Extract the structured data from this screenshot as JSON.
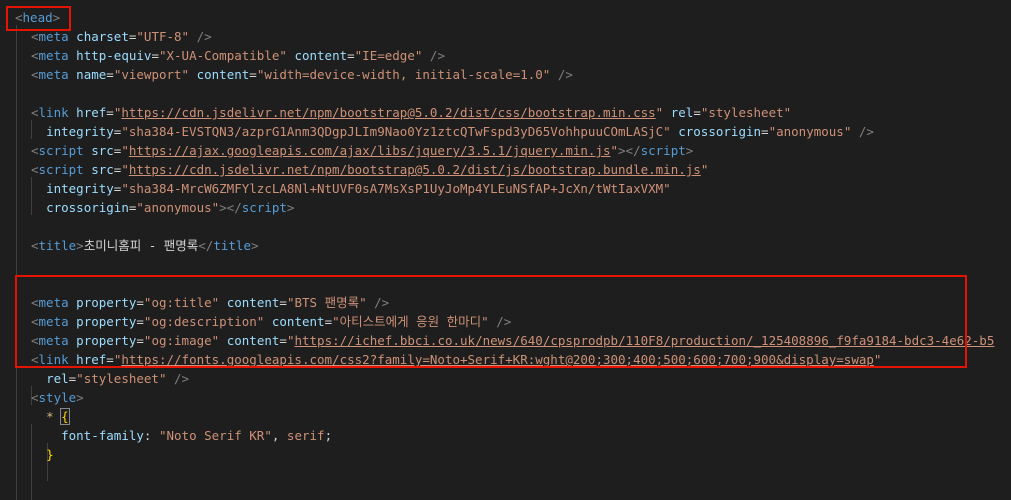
{
  "lines": [
    {
      "tokens": [
        [
          "br",
          "<"
        ],
        [
          "tag",
          "head"
        ],
        [
          "br",
          ">"
        ]
      ]
    },
    {
      "tokens": [
        [
          "br",
          "<"
        ],
        [
          "tag",
          "meta"
        ],
        [
          "sp",
          " "
        ],
        [
          "attr",
          "charset"
        ],
        [
          "eq",
          "="
        ],
        [
          "str",
          "\"UTF-8\""
        ],
        [
          "sp",
          " "
        ],
        [
          "br",
          "/>"
        ]
      ]
    },
    {
      "tokens": [
        [
          "br",
          "<"
        ],
        [
          "tag",
          "meta"
        ],
        [
          "sp",
          " "
        ],
        [
          "attr",
          "http-equiv"
        ],
        [
          "eq",
          "="
        ],
        [
          "str",
          "\"X-UA-Compatible\""
        ],
        [
          "sp",
          " "
        ],
        [
          "attr",
          "content"
        ],
        [
          "eq",
          "="
        ],
        [
          "str",
          "\"IE=edge\""
        ],
        [
          "sp",
          " "
        ],
        [
          "br",
          "/>"
        ]
      ]
    },
    {
      "tokens": [
        [
          "br",
          "<"
        ],
        [
          "tag",
          "meta"
        ],
        [
          "sp",
          " "
        ],
        [
          "attr",
          "name"
        ],
        [
          "eq",
          "="
        ],
        [
          "str",
          "\"viewport\""
        ],
        [
          "sp",
          " "
        ],
        [
          "attr",
          "content"
        ],
        [
          "eq",
          "="
        ],
        [
          "str",
          "\"width=device-width, initial-scale=1.0\""
        ],
        [
          "sp",
          " "
        ],
        [
          "br",
          "/>"
        ]
      ]
    },
    {
      "tokens": []
    },
    {
      "tokens": [
        [
          "br",
          "<"
        ],
        [
          "tag",
          "link"
        ],
        [
          "sp",
          " "
        ],
        [
          "attr",
          "href"
        ],
        [
          "eq",
          "="
        ],
        [
          "str",
          "\""
        ],
        [
          "url",
          "https://cdn.jsdelivr.net/npm/bootstrap@5.0.2/dist/css/bootstrap.min.css"
        ],
        [
          "str",
          "\""
        ],
        [
          "sp",
          " "
        ],
        [
          "attr",
          "rel"
        ],
        [
          "eq",
          "="
        ],
        [
          "str",
          "\"stylesheet\""
        ]
      ]
    },
    {
      "tokens": [
        [
          "sp",
          "  "
        ],
        [
          "attr",
          "integrity"
        ],
        [
          "eq",
          "="
        ],
        [
          "str",
          "\"sha384-EVSTQN3/azprG1Anm3QDgpJLIm9Nao0Yz1ztcQTwFspd3yD65VohhpuuCOmLASjC\""
        ],
        [
          "sp",
          " "
        ],
        [
          "attr",
          "crossorigin"
        ],
        [
          "eq",
          "="
        ],
        [
          "str",
          "\"anonymous\""
        ],
        [
          "sp",
          " "
        ],
        [
          "br",
          "/>"
        ]
      ]
    },
    {
      "tokens": [
        [
          "br",
          "<"
        ],
        [
          "tag",
          "script"
        ],
        [
          "sp",
          " "
        ],
        [
          "attr",
          "src"
        ],
        [
          "eq",
          "="
        ],
        [
          "str",
          "\""
        ],
        [
          "url",
          "https://ajax.googleapis.com/ajax/libs/jquery/3.5.1/jquery.min.js"
        ],
        [
          "str",
          "\""
        ],
        [
          "br",
          "></"
        ],
        [
          "tag",
          "script"
        ],
        [
          "br",
          ">"
        ]
      ]
    },
    {
      "tokens": [
        [
          "br",
          "<"
        ],
        [
          "tag",
          "script"
        ],
        [
          "sp",
          " "
        ],
        [
          "attr",
          "src"
        ],
        [
          "eq",
          "="
        ],
        [
          "str",
          "\""
        ],
        [
          "url",
          "https://cdn.jsdelivr.net/npm/bootstrap@5.0.2/dist/js/bootstrap.bundle.min.js"
        ],
        [
          "str",
          "\""
        ]
      ]
    },
    {
      "tokens": [
        [
          "sp",
          "  "
        ],
        [
          "attr",
          "integrity"
        ],
        [
          "eq",
          "="
        ],
        [
          "str",
          "\"sha384-MrcW6ZMFYlzcLA8Nl+NtUVF0sA7MsXsP1UyJoMp4YLEuNSfAP+JcXn/tWtIaxVXM\""
        ]
      ]
    },
    {
      "tokens": [
        [
          "sp",
          "  "
        ],
        [
          "attr",
          "crossorigin"
        ],
        [
          "eq",
          "="
        ],
        [
          "str",
          "\"anonymous\""
        ],
        [
          "br",
          "></"
        ],
        [
          "tag",
          "script"
        ],
        [
          "br",
          ">"
        ]
      ]
    },
    {
      "tokens": []
    },
    {
      "tokens": [
        [
          "br",
          "<"
        ],
        [
          "tag",
          "title"
        ],
        [
          "br",
          ">"
        ],
        [
          "text",
          "초미니홈피 - 팬명록"
        ],
        [
          "br",
          "</"
        ],
        [
          "tag",
          "title"
        ],
        [
          "br",
          ">"
        ]
      ]
    },
    {
      "tokens": []
    },
    {
      "tokens": []
    },
    {
      "tokens": [
        [
          "br",
          "<"
        ],
        [
          "tag",
          "meta"
        ],
        [
          "sp",
          " "
        ],
        [
          "attr",
          "property"
        ],
        [
          "eq",
          "="
        ],
        [
          "str",
          "\"og:title\""
        ],
        [
          "sp",
          " "
        ],
        [
          "attr",
          "content"
        ],
        [
          "eq",
          "="
        ],
        [
          "str",
          "\"BTS 팬명록\""
        ],
        [
          "sp",
          " "
        ],
        [
          "br",
          "/>"
        ]
      ]
    },
    {
      "tokens": [
        [
          "br",
          "<"
        ],
        [
          "tag",
          "meta"
        ],
        [
          "sp",
          " "
        ],
        [
          "attr",
          "property"
        ],
        [
          "eq",
          "="
        ],
        [
          "str",
          "\"og:description\""
        ],
        [
          "sp",
          " "
        ],
        [
          "attr",
          "content"
        ],
        [
          "eq",
          "="
        ],
        [
          "str",
          "\"아티스트에게 응원 한마디\""
        ],
        [
          "sp",
          " "
        ],
        [
          "br",
          "/>"
        ]
      ]
    },
    {
      "tokens": [
        [
          "br",
          "<"
        ],
        [
          "tag",
          "meta"
        ],
        [
          "sp",
          " "
        ],
        [
          "attr",
          "property"
        ],
        [
          "eq",
          "="
        ],
        [
          "str",
          "\"og:image\""
        ],
        [
          "sp",
          " "
        ],
        [
          "attr",
          "content"
        ],
        [
          "eq",
          "="
        ],
        [
          "str",
          "\""
        ],
        [
          "url",
          "https://ichef.bbci.co.uk/news/640/cpsprodpb/110F8/production/_125408896_f9fa9184-bdc3-4e62-b5"
        ]
      ]
    },
    {
      "tokens": [
        [
          "br",
          "<"
        ],
        [
          "tag",
          "link"
        ],
        [
          "sp",
          " "
        ],
        [
          "attr",
          "href"
        ],
        [
          "eq",
          "="
        ],
        [
          "str",
          "\""
        ],
        [
          "url",
          "https://fonts.googleapis.com/css2?family=Noto+Serif+KR:wght@200;300;400;500;600;700;900&display=swap"
        ],
        [
          "str",
          "\""
        ]
      ]
    },
    {
      "tokens": [
        [
          "sp",
          "  "
        ],
        [
          "attr",
          "rel"
        ],
        [
          "eq",
          "="
        ],
        [
          "str",
          "\"stylesheet\""
        ],
        [
          "sp",
          " "
        ],
        [
          "br",
          "/>"
        ]
      ]
    },
    {
      "tokens": [
        [
          "br",
          "<"
        ],
        [
          "tag",
          "style"
        ],
        [
          "br",
          ">"
        ]
      ]
    },
    {
      "tokens": [
        [
          "sp",
          "  "
        ],
        [
          "sel",
          "*"
        ],
        [
          "sp",
          " "
        ],
        [
          "brace",
          "{"
        ]
      ]
    },
    {
      "tokens": [
        [
          "sp",
          "    "
        ],
        [
          "prop",
          "font-family"
        ],
        [
          "punc",
          ": "
        ],
        [
          "str",
          "\"Noto Serif KR\""
        ],
        [
          "punc",
          ", "
        ],
        [
          "str",
          "serif"
        ],
        [
          "punc",
          ";"
        ]
      ]
    },
    {
      "tokens": [
        [
          "sp",
          "  "
        ],
        [
          "brace",
          "}"
        ]
      ]
    },
    {
      "tokens": []
    },
    {
      "tokens": []
    }
  ]
}
